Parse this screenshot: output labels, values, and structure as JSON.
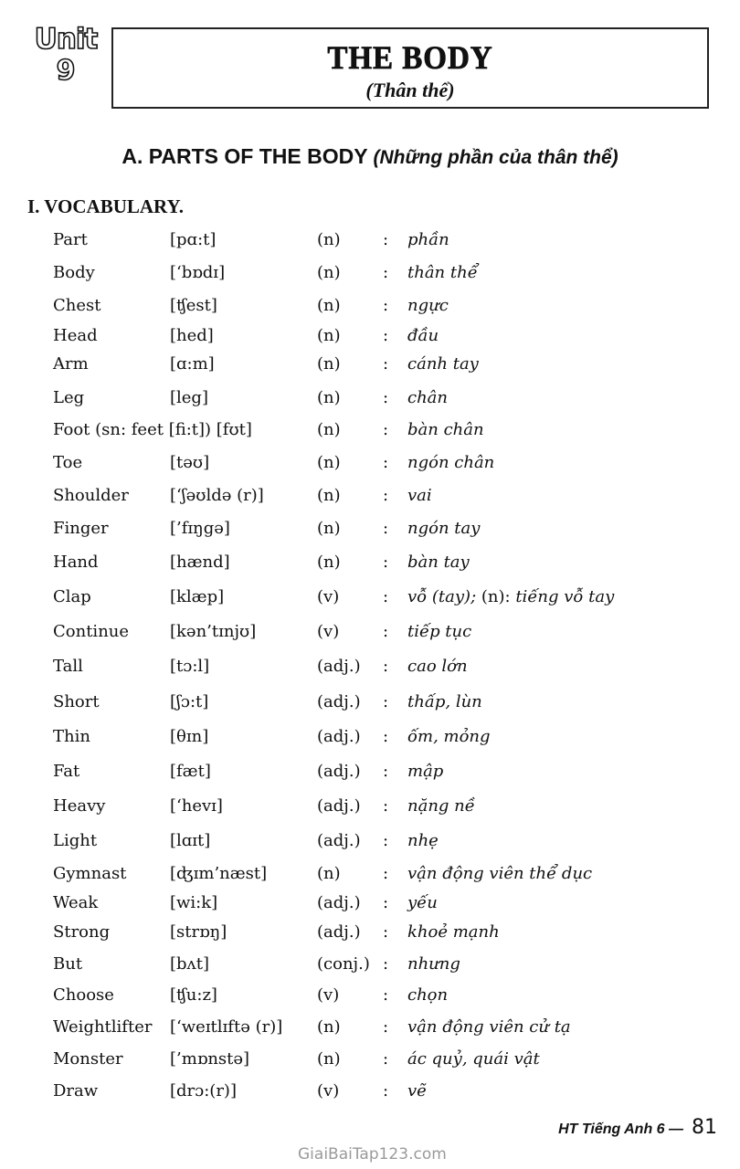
{
  "unit": {
    "word": "Unit",
    "number": "9"
  },
  "title": {
    "main": "THE BODY",
    "sub": "(Thân thể)"
  },
  "section": {
    "label": "A. PARTS OF THE BODY",
    "label_vi": "(Những phần của thân thể)"
  },
  "subsection": {
    "label": "I. VOCABULARY."
  },
  "vocabulary": [
    {
      "word": "Part",
      "ipa": "[pɑ:t]",
      "pos": "(n)",
      "meaning": "phần"
    },
    {
      "word": "Body",
      "ipa": "[‘bɒdɪ]",
      "pos": "(n)",
      "meaning": "thân thể"
    },
    {
      "word": "Chest",
      "ipa": "[ʧest]",
      "pos": "(n)",
      "meaning": "ngực"
    },
    {
      "word": "Head",
      "ipa": "[hed]",
      "pos": "(n)",
      "meaning": "đầu"
    },
    {
      "word": "Arm",
      "ipa": "[ɑ:m]",
      "pos": "(n)",
      "meaning": "cánh tay"
    },
    {
      "word": "Leg",
      "ipa": "[leg]",
      "pos": "(n)",
      "meaning": "chân"
    },
    {
      "word": "Foot (sn: feet [fi:t]) [fʊt]",
      "ipa": "",
      "pos": "(n)",
      "meaning": "bàn chân"
    },
    {
      "word": "Toe",
      "ipa": "[təʊ]",
      "pos": "(n)",
      "meaning": "ngón chân"
    },
    {
      "word": "Shoulder",
      "ipa": "[‘ʃəʊldə (r)]",
      "pos": "(n)",
      "meaning": "vai"
    },
    {
      "word": "Finger",
      "ipa": "[’fɪŋgə]",
      "pos": "(n)",
      "meaning": "ngón tay"
    },
    {
      "word": "Hand",
      "ipa": "[hænd]",
      "pos": "(n)",
      "meaning": "bàn tay"
    },
    {
      "word": "Clap",
      "ipa": "[klæp]",
      "pos": "(v)",
      "meaning": "vỗ (tay);",
      "meaning_pos": "(n):",
      "meaning_extra": "tiếng vỗ tay"
    },
    {
      "word": "Continue",
      "ipa": "[kən’tɪnjʊ]",
      "pos": "(v)",
      "meaning": "tiếp tục"
    },
    {
      "word": "Tall",
      "ipa": "[tɔ:l]",
      "pos": "(adj.)",
      "meaning": "cao lớn"
    },
    {
      "word": "Short",
      "ipa": "[ʃɔ:t]",
      "pos": "(adj.)",
      "meaning": "thấp, lùn"
    },
    {
      "word": "Thin",
      "ipa": "[θɪn]",
      "pos": "(adj.)",
      "meaning": "ốm, mỏng"
    },
    {
      "word": "Fat",
      "ipa": "[fæt]",
      "pos": "(adj.)",
      "meaning": "mập"
    },
    {
      "word": "Heavy",
      "ipa": "[‘hevɪ]",
      "pos": "(adj.)",
      "meaning": "nặng nề"
    },
    {
      "word": "Light",
      "ipa": "[lɑɪt]",
      "pos": "(adj.)",
      "meaning": "nhẹ"
    },
    {
      "word": "Gymnast",
      "ipa": "[ʤɪm’næst]",
      "pos": "(n)",
      "meaning": "vận động viên thể dục"
    },
    {
      "word": "Weak",
      "ipa": "[wi:k]",
      "pos": "(adj.)",
      "meaning": "yếu"
    },
    {
      "word": "Strong",
      "ipa": "[strɒŋ]",
      "pos": "(adj.)",
      "meaning": "khoẻ mạnh"
    },
    {
      "word": "But",
      "ipa": "[bʌt]",
      "pos": "(conj.)",
      "meaning": "nhưng"
    },
    {
      "word": "Choose",
      "ipa": "[ʧu:z]",
      "pos": "(v)",
      "meaning": "chọn"
    },
    {
      "word": "Weightlifter",
      "ipa": "[‘weɪtlɪftə (r)]",
      "pos": "(n)",
      "meaning": "vận động viên cử tạ"
    },
    {
      "word": "Monster",
      "ipa": "[’mɒnstə]",
      "pos": "(n)",
      "meaning": "ác quỷ, quái vật"
    },
    {
      "word": "Draw",
      "ipa": "[drɔ:(r)]",
      "pos": "(v)",
      "meaning": "vẽ"
    }
  ],
  "separator": ":",
  "footer": {
    "book": "HT Tiếng Anh 6 —",
    "page": "81",
    "watermark": "GiaiBaiTap123.com"
  }
}
